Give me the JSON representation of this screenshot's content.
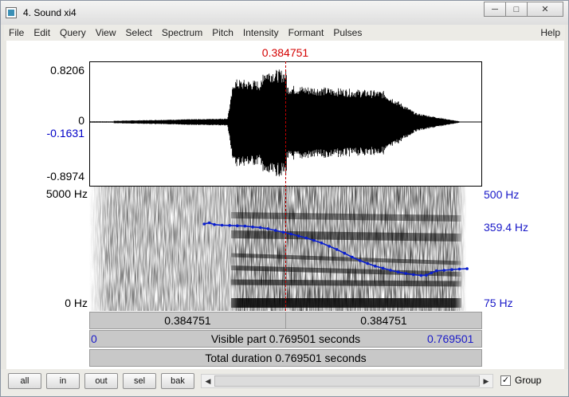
{
  "window": {
    "title": "4. Sound xi4",
    "minimize_glyph": "─",
    "maximize_glyph": "□",
    "close_glyph": "✕"
  },
  "menu": {
    "items": [
      "File",
      "Edit",
      "Query",
      "View",
      "Select",
      "Spectrum",
      "Pitch",
      "Intensity",
      "Formant",
      "Pulses"
    ],
    "help": "Help"
  },
  "cursor": {
    "time_label": "0.384751",
    "time": 0.384751
  },
  "waveform": {
    "y_max_label": "0.8206",
    "zero_label": "0",
    "cursor_value_label": "-0.1631",
    "y_min_label": "-0.8974"
  },
  "spectrogram": {
    "top_label": "5000 Hz",
    "bottom_label": "0 Hz"
  },
  "pitch": {
    "top_label": "500 Hz",
    "cursor_label": "359.4 Hz",
    "bottom_label": "75 Hz",
    "color": "#0a1ecc",
    "points": [
      [
        0.225,
        372
      ],
      [
        0.235,
        376
      ],
      [
        0.245,
        370
      ],
      [
        0.26,
        368
      ],
      [
        0.275,
        367
      ],
      [
        0.29,
        366
      ],
      [
        0.305,
        365
      ],
      [
        0.32,
        362
      ],
      [
        0.335,
        360
      ],
      [
        0.35,
        356
      ],
      [
        0.365,
        350
      ],
      [
        0.38,
        344
      ],
      [
        0.395,
        338
      ],
      [
        0.41,
        331
      ],
      [
        0.425,
        324
      ],
      [
        0.44,
        316
      ],
      [
        0.455,
        307
      ],
      [
        0.47,
        296
      ],
      [
        0.485,
        285
      ],
      [
        0.5,
        272
      ],
      [
        0.515,
        259
      ],
      [
        0.53,
        247
      ],
      [
        0.545,
        237
      ],
      [
        0.56,
        228
      ],
      [
        0.575,
        221
      ],
      [
        0.59,
        214
      ],
      [
        0.605,
        208
      ],
      [
        0.62,
        203
      ],
      [
        0.635,
        199
      ],
      [
        0.65,
        196
      ],
      [
        0.66,
        197
      ],
      [
        0.67,
        205
      ],
      [
        0.68,
        212
      ],
      [
        0.695,
        214
      ],
      [
        0.71,
        216
      ],
      [
        0.725,
        218
      ],
      [
        0.74,
        219
      ]
    ]
  },
  "time_bars": {
    "left_segment": "0.384751",
    "right_segment": "0.384751",
    "visible_start": "0",
    "visible_part": "Visible part 0.769501 seconds",
    "visible_end": "0.769501",
    "total_duration": "Total duration 0.769501 seconds"
  },
  "toolbar": {
    "buttons": [
      "all",
      "in",
      "out",
      "sel",
      "bak"
    ],
    "scroll_left": "◀",
    "scroll_right": "▶",
    "group_checked": "✓",
    "group_label": "Group"
  }
}
